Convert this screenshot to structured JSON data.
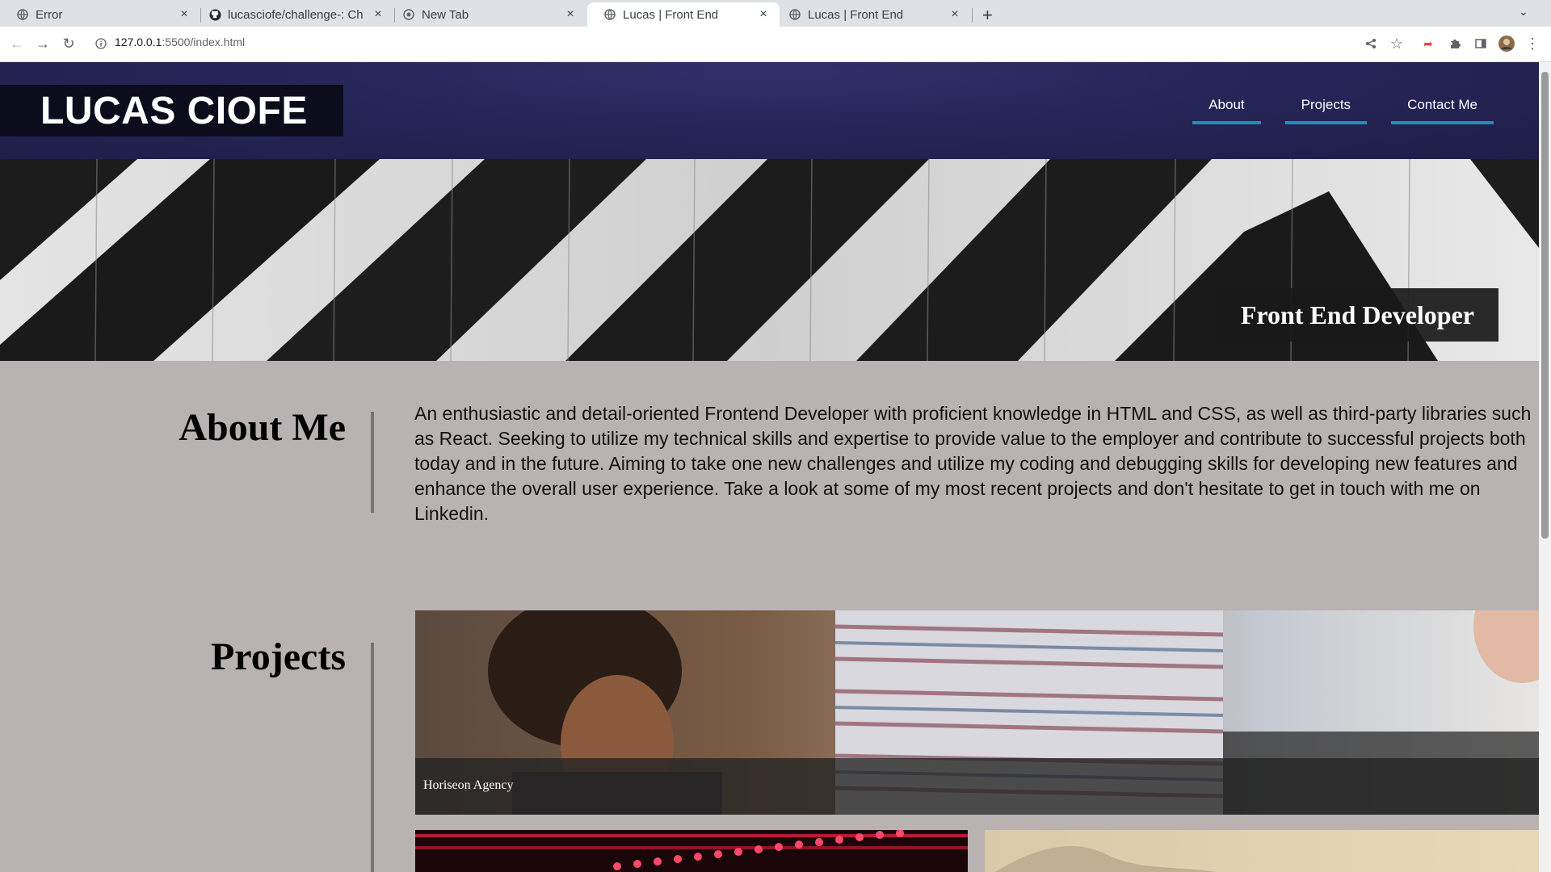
{
  "browser": {
    "tabs": [
      {
        "title": "Error",
        "active": false
      },
      {
        "title": "lucasciofe/challenge-: Ch",
        "active": false
      },
      {
        "title": "New Tab",
        "active": false
      },
      {
        "title": "Lucas | Front End",
        "active": true
      },
      {
        "title": "Lucas | Front End",
        "active": false
      }
    ],
    "url_host": "127.0.0.1",
    "url_path": ":5500/index.html"
  },
  "site": {
    "logo": "LUCAS CIOFE",
    "nav": [
      "About",
      "Projects",
      "Contact Me"
    ],
    "hero_tag": "Front End Developer",
    "about": {
      "title": "About Me",
      "text": "An enthusiastic and detail-oriented Frontend Developer with proficient knowledge in HTML and CSS, as well as third-party libraries such as React. Seeking to utilize my technical skills and expertise to provide value to the employer and contribute to successful projects both today and in the future. Aiming to take one new challenges and utilize my coding and debugging skills for developing new features and enhance the overall user experience. Take a look at some of my most recent projects and don't hesitate to get in touch with me on Linkedin."
    },
    "projects": {
      "title": "Projects",
      "featured_label": "Horiseon Agency"
    }
  },
  "colors": {
    "header_bg": "#27265a",
    "nav_underline": "#1f8fb4",
    "page_bg": "#b9b2b2"
  }
}
